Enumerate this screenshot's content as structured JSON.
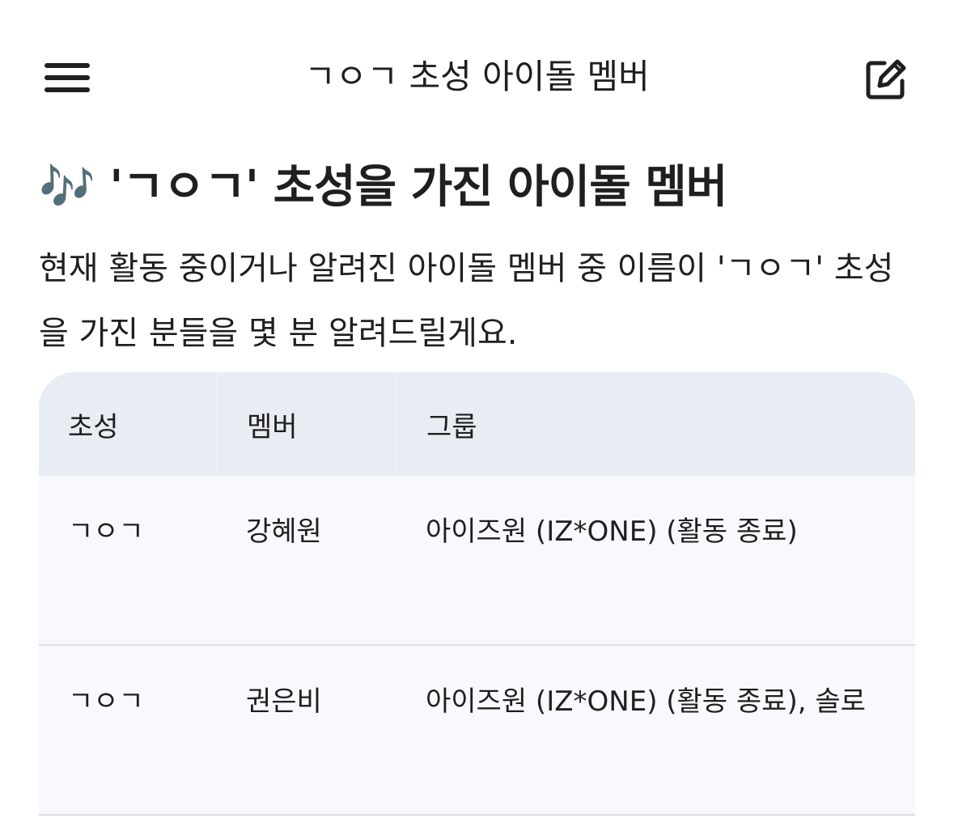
{
  "header": {
    "title": "ㄱㅇㄱ 초성 아이돌 멤버",
    "menu_icon": "hamburger-menu-icon",
    "edit_icon": "edit-square-pencil-icon"
  },
  "article": {
    "heading": "🎶 'ㄱㅇㄱ' 초성을 가진 아이돌 멤버",
    "intro": "현재 활동 중이거나 알려진 아이돌 멤버 중 이름이 'ㄱㅇㄱ' 초성을 가진 분들을 몇 분 알려드릴게요."
  },
  "table": {
    "headers": [
      "초성",
      "멤버",
      "그룹"
    ],
    "rows": [
      {
        "initials": "ㄱㅇㄱ",
        "member": "강혜원",
        "group": "아이즈원 (IZ*ONE) (활동 종료)"
      },
      {
        "initials": "ㄱㅇㄱ",
        "member": "권은비",
        "group": "아이즈원 (IZ*ONE) (활동 종료), 솔로"
      }
    ]
  },
  "colors": {
    "table_header_bg": "#e8edf3",
    "table_body_bg": "#f8f9fc",
    "row_divider": "#dcdfe4",
    "text": "#1f1f1f"
  }
}
